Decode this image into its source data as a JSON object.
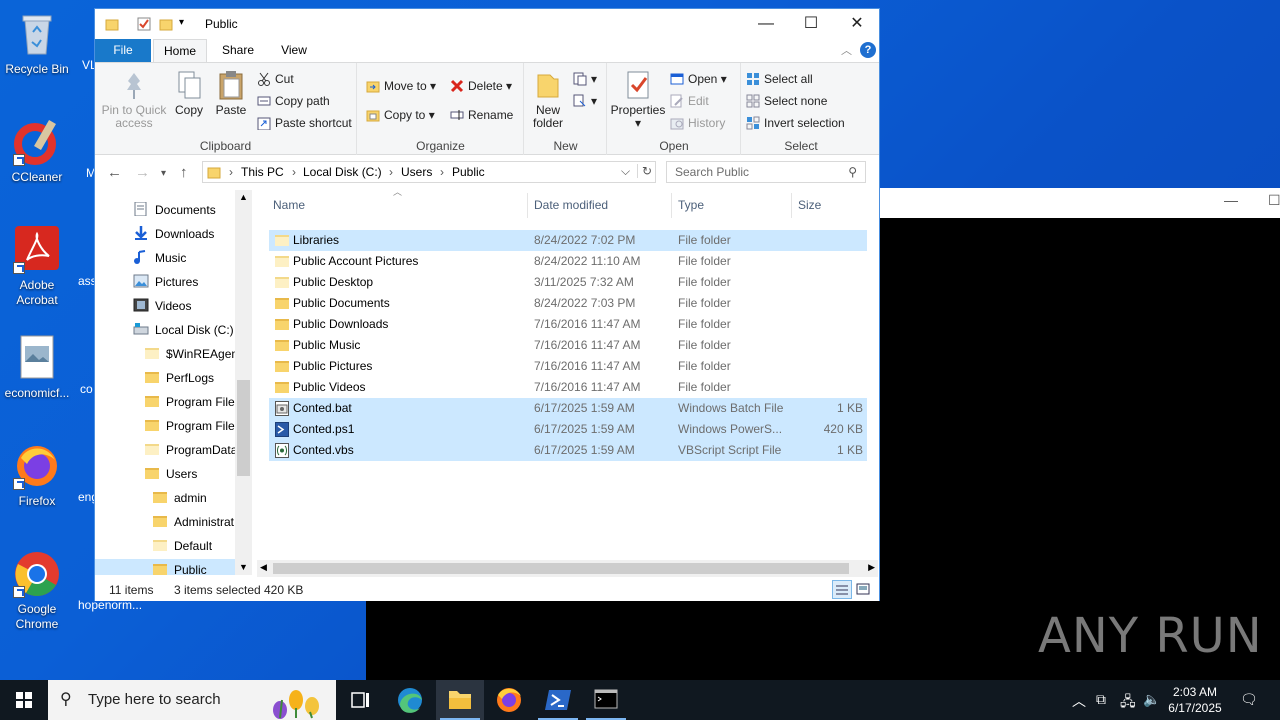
{
  "desktop": {
    "icons": [
      {
        "label": "Recycle Bin",
        "icon": "recycle-bin-icon"
      },
      {
        "label": "CCleaner",
        "icon": "ccleaner-icon"
      },
      {
        "label": "Adobe Acrobat",
        "icon": "adobe-acrobat-icon"
      },
      {
        "label": "economicf...",
        "icon": "image-file-icon"
      },
      {
        "label": "Firefox",
        "icon": "firefox-icon"
      },
      {
        "label": "Google Chrome",
        "icon": "chrome-icon"
      }
    ],
    "partial_icons": [
      "VL",
      "M",
      "ass",
      "co",
      "eng",
      "hopenorm..."
    ]
  },
  "explorer": {
    "title": "Public",
    "tabs": {
      "file": "File",
      "home": "Home",
      "share": "Share",
      "view": "View"
    },
    "ribbon": {
      "clipboard": {
        "label": "Clipboard",
        "pin": "Pin to Quick access",
        "pin_line1": "Pin to Quick",
        "pin_line2": "access",
        "copy": "Copy",
        "paste": "Paste",
        "cut": "Cut",
        "copy_path": "Copy path",
        "paste_shortcut": "Paste shortcut"
      },
      "organize": {
        "label": "Organize",
        "move_to": "Move to",
        "copy_to": "Copy to",
        "delete": "Delete",
        "rename": "Rename"
      },
      "new": {
        "label": "New",
        "new_folder_line1": "New",
        "new_folder_line2": "folder"
      },
      "open": {
        "label": "Open",
        "properties": "Properties",
        "open": "Open",
        "edit": "Edit",
        "history": "History"
      },
      "select": {
        "label": "Select",
        "select_all": "Select all",
        "select_none": "Select none",
        "invert": "Invert selection"
      }
    },
    "address": {
      "crumbs": [
        "This PC",
        "Local Disk (C:)",
        "Users",
        "Public"
      ],
      "search_placeholder": "Search Public"
    },
    "nav_items": [
      {
        "label": "Documents",
        "kind": "documents-icon"
      },
      {
        "label": "Downloads",
        "kind": "downloads-icon"
      },
      {
        "label": "Music",
        "kind": "music-icon"
      },
      {
        "label": "Pictures",
        "kind": "pictures-icon"
      },
      {
        "label": "Videos",
        "kind": "videos-icon"
      },
      {
        "label": "Local Disk (C:)",
        "kind": "drive-icon"
      },
      {
        "label": "$WinREAgent",
        "kind": "folder-pale"
      },
      {
        "label": "PerfLogs",
        "kind": "folder"
      },
      {
        "label": "Program Files",
        "kind": "folder"
      },
      {
        "label": "Program Files",
        "kind": "folder"
      },
      {
        "label": "ProgramData",
        "kind": "folder-pale"
      },
      {
        "label": "Users",
        "kind": "folder"
      },
      {
        "label": "admin",
        "kind": "folder"
      },
      {
        "label": "Administrat",
        "kind": "folder"
      },
      {
        "label": "Default",
        "kind": "folder-pale"
      },
      {
        "label": "Public",
        "kind": "folder"
      }
    ],
    "columns": {
      "name": "Name",
      "date": "Date modified",
      "type": "Type",
      "size": "Size"
    },
    "files": [
      {
        "name": "Libraries",
        "date": "8/24/2022 7:02 PM",
        "type": "File folder",
        "size": "",
        "kind": "folder-pale"
      },
      {
        "name": "Public Account Pictures",
        "date": "8/24/2022 11:10 AM",
        "type": "File folder",
        "size": "",
        "kind": "folder-pale"
      },
      {
        "name": "Public Desktop",
        "date": "3/11/2025 7:32 AM",
        "type": "File folder",
        "size": "",
        "kind": "folder-pale"
      },
      {
        "name": "Public Documents",
        "date": "8/24/2022 7:03 PM",
        "type": "File folder",
        "size": "",
        "kind": "folder"
      },
      {
        "name": "Public Downloads",
        "date": "7/16/2016 11:47 AM",
        "type": "File folder",
        "size": "",
        "kind": "folder"
      },
      {
        "name": "Public Music",
        "date": "7/16/2016 11:47 AM",
        "type": "File folder",
        "size": "",
        "kind": "folder"
      },
      {
        "name": "Public Pictures",
        "date": "7/16/2016 11:47 AM",
        "type": "File folder",
        "size": "",
        "kind": "folder"
      },
      {
        "name": "Public Videos",
        "date": "7/16/2016 11:47 AM",
        "type": "File folder",
        "size": "",
        "kind": "folder"
      },
      {
        "name": "Conted.bat",
        "date": "6/17/2025 1:59 AM",
        "type": "Windows Batch File",
        "size": "1 KB",
        "kind": "bat"
      },
      {
        "name": "Conted.ps1",
        "date": "6/17/2025 1:59 AM",
        "type": "Windows PowerS...",
        "size": "420 KB",
        "kind": "ps1"
      },
      {
        "name": "Conted.vbs",
        "date": "6/17/2025 1:59 AM",
        "type": "VBScript Script File",
        "size": "1 KB",
        "kind": "vbs"
      }
    ],
    "status": {
      "count": "11 items",
      "selected": "3 items selected",
      "size": "420 KB"
    }
  },
  "taskbar": {
    "search_placeholder": "Type here to search",
    "time": "2:03 AM",
    "date": "6/17/2025"
  },
  "watermark": "ANY RUN",
  "colors": {
    "desktop": "#0b5fd6",
    "selection": "#cce8ff",
    "file_tab": "#1979ca",
    "folder": "#f8d46c"
  }
}
